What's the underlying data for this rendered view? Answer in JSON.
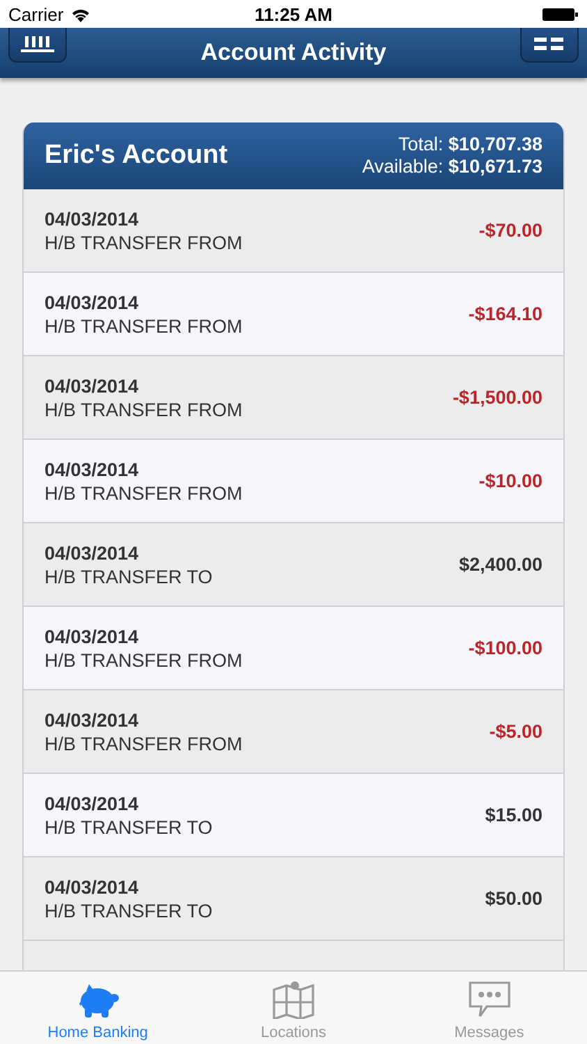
{
  "status_bar": {
    "carrier": "Carrier",
    "time": "11:25 AM"
  },
  "nav": {
    "title": "Account Activity"
  },
  "account": {
    "name": "Eric's Account",
    "total_label": "Total:",
    "total": "$10,707.38",
    "available_label": "Available:",
    "available": "$10,671.73"
  },
  "transactions": [
    {
      "date": "04/03/2014",
      "description": "H/B TRANSFER FROM",
      "amount": "-$70.00",
      "kind": "debit"
    },
    {
      "date": "04/03/2014",
      "description": "H/B TRANSFER FROM",
      "amount": "-$164.10",
      "kind": "debit"
    },
    {
      "date": "04/03/2014",
      "description": "H/B TRANSFER FROM",
      "amount": "-$1,500.00",
      "kind": "debit"
    },
    {
      "date": "04/03/2014",
      "description": "H/B TRANSFER FROM",
      "amount": "-$10.00",
      "kind": "debit"
    },
    {
      "date": "04/03/2014",
      "description": "H/B TRANSFER TO",
      "amount": "$2,400.00",
      "kind": "credit"
    },
    {
      "date": "04/03/2014",
      "description": "H/B TRANSFER FROM",
      "amount": "-$100.00",
      "kind": "debit"
    },
    {
      "date": "04/03/2014",
      "description": "H/B TRANSFER FROM",
      "amount": "-$5.00",
      "kind": "debit"
    },
    {
      "date": "04/03/2014",
      "description": "H/B TRANSFER TO",
      "amount": "$15.00",
      "kind": "credit"
    },
    {
      "date": "04/03/2014",
      "description": "H/B TRANSFER TO",
      "amount": "$50.00",
      "kind": "credit"
    }
  ],
  "tab_bar": [
    {
      "label": "Home Banking",
      "kind": "piggy",
      "selected": true
    },
    {
      "label": "Locations",
      "kind": "map",
      "selected": false
    },
    {
      "label": "Messages",
      "kind": "chat",
      "selected": false
    }
  ]
}
